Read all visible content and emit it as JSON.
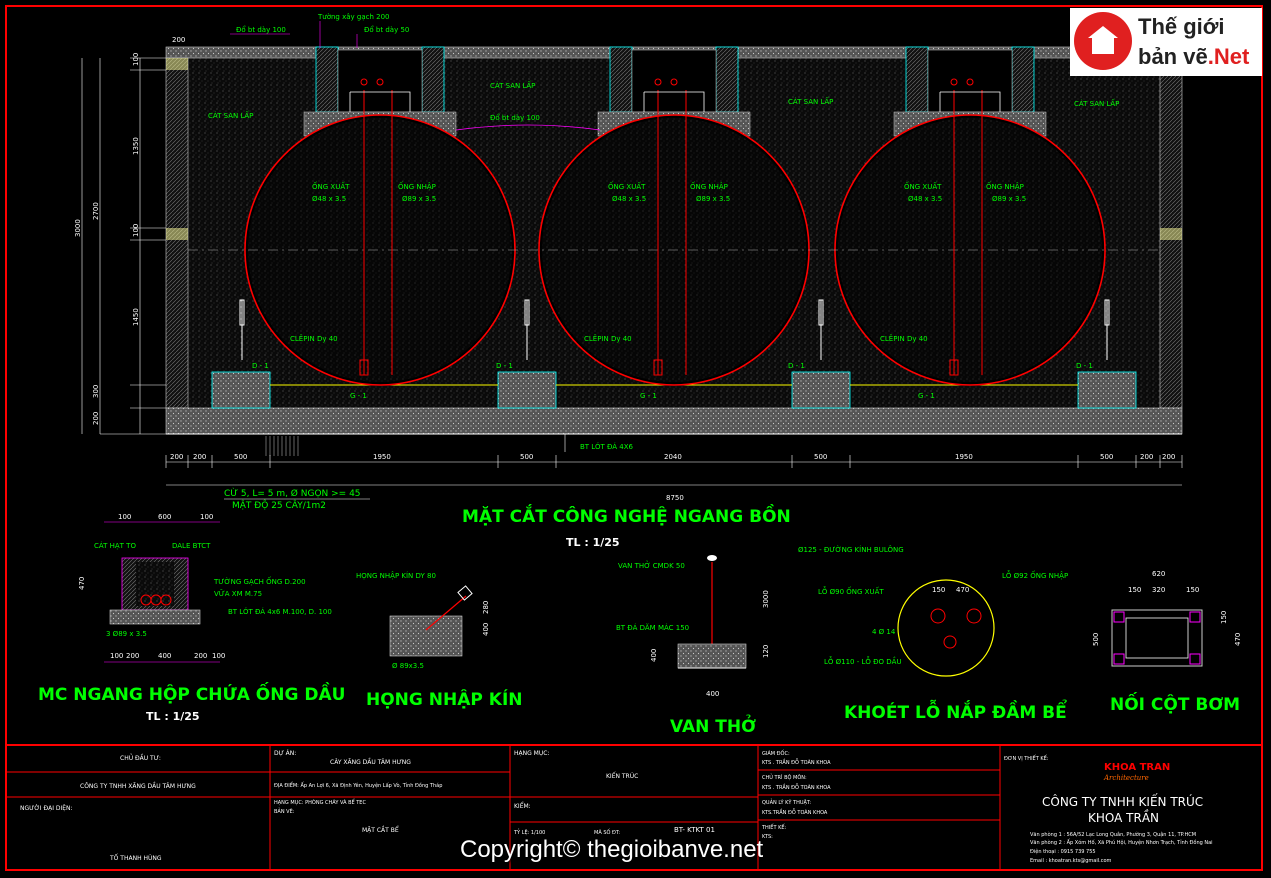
{
  "logo": {
    "line1": "Thế giới",
    "line2": "bản vẽ",
    "line2b": ".Net"
  },
  "watermark": "Copyright© thegioibanve.net",
  "main_title": "MẶT CẮT CÔNG NGHỆ NGANG BỒN",
  "main_scale": "TL : 1/25",
  "detail_titles": {
    "hop": "MC NGANG HỘP CHỨA ỐNG DẦU",
    "hop_scale": "TL : 1/25",
    "hong": "HỌNG NHẬP KÍN",
    "van": "VAN THỞ",
    "khoet": "KHOÉT LỖ NẮP ĐẦM BỂ",
    "noi": "NỐI CỘT BƠM"
  },
  "top_labels": {
    "t1": "Đổ bt dày 100",
    "t2": "Tường xây gạch 200",
    "t3": "Đổ bt dày 50",
    "cat1": "CÁT SAN LẤP",
    "cat2": "CÁT SAN LẤP",
    "cat3": "CÁT SAN LẤP",
    "cat4": "CÁT SAN LẤP",
    "bt100": "Đổ bt dày 100"
  },
  "tank_labels": {
    "xuat": "ỐNG XUẤT",
    "xuat_d": "Ø48 x 3.5",
    "nhap": "ỐNG NHẬP",
    "nhap_d": "Ø89 x 3.5",
    "clepin": "CLÊPIN Dy 40",
    "d1": "D - 1",
    "g1": "G - 1"
  },
  "bottom_labels": {
    "btlot": "BT LÓT ĐÁ 4X6",
    "cu": "CỪ 5, L= 5 m, Ø NGỌN >= 45",
    "matdo": "MẬT ĐỘ 25 CÂY/1m2"
  },
  "dims_bottom": [
    "200",
    "200",
    "500",
    "1950",
    "500",
    "2040",
    "500",
    "1950",
    "500",
    "200",
    "200"
  ],
  "dim_total": "8750",
  "dims_left": {
    "d100": "100",
    "d1350": "1350",
    "d100b": "100",
    "d1450": "1450",
    "d300": "300",
    "d200": "200",
    "d2700": "2700",
    "d3000": "3000",
    "d200top": "200",
    "d300b": "300"
  },
  "hop": {
    "cat": "CÁT HẠT TO",
    "dale": "DALE BTCT",
    "tuong": "TƯỜNG GẠCH ỐNG D.200",
    "vua": "VỮA XM M.75",
    "btlot": "BT LÓT ĐÁ 4x6 M.100, D. 100",
    "ong": "3 Ø89 x 3.5",
    "d100": "100",
    "d600": "600",
    "d100b": "100",
    "d470": "470",
    "dims": [
      "100",
      "200",
      "400",
      "200",
      "100"
    ]
  },
  "hong": {
    "lbl": "HỌNG NHẬP KÍN DY 80",
    "ong": "Ø 89x3.5",
    "d280": "280",
    "d400": "400"
  },
  "van": {
    "lbl1": "VAN THỞ CMDK 50",
    "lbl2": "BT ĐÁ DĂM MÁC 150",
    "d3000": "3000",
    "d400": "400",
    "d400b": "400",
    "d120": "120"
  },
  "khoet": {
    "l1": "Ø125 - ĐƯỜNG KÍNH BULÔNG",
    "l2": "LỖ Ø92 ỐNG NHẬP",
    "l3": "LỖ Ø90 ỐNG XUẤT",
    "l4": "4 Ø 14",
    "l5": "LỖ Ø110 - LỖ ĐO DẦU",
    "d150": "150",
    "d470": "470"
  },
  "noi": {
    "d620": "620",
    "dims": [
      "150",
      "320",
      "150"
    ],
    "d500": "500",
    "d150": "150",
    "d470": "470"
  },
  "titleblock": {
    "chu_dau_tu_lbl": "CHỦ ĐẦU TƯ:",
    "chu_dau_tu": "CÔNG TY TNHH XĂNG DẦU TÂM HƯNG",
    "nguoi_dai_dien_lbl": "NGƯỜI ĐẠI DIỆN:",
    "nguoi_dai_dien": "TỐ THANH HÙNG",
    "du_an_lbl": "DỰ ÁN:",
    "du_an": "CÂY XĂNG DẦU TÂM HƯNG",
    "dia_diem": "ĐỊA ĐIỂM:   Ấp An Lợi 6, Xã Định Yên, Huyện Lấp Vò, Tỉnh Đồng Tháp",
    "hang_muc_pc": "HẠNG MỤC: PHÒNG CHÁY VÀ BỂ TEC",
    "ban_ve_lbl": "BẢN VẼ:",
    "ban_ve": "MẶT CẮT BỂ",
    "hang_muc_lbl": "HẠNG MỤC:",
    "hang_muc": "KIẾN TRÚC",
    "kiem_lbl": "KIỂM:",
    "ty_le": "TỶ LỆ:  1/100",
    "ma_so": "MÃ SỐ ĐT:",
    "ma": "BT- KTKT 01",
    "giam_doc_lbl": "GIÁM ĐỐC:",
    "giam_doc": "KTS . TRẦN ĐỖ TOÀN KHOA",
    "chu_tri_lbl": "CHỦ TRÌ BỘ MÔN:",
    "chu_tri": "KTS . TRẦN ĐỖ TOÀN KHOA",
    "quan_ly_lbl": "QUẢN LÝ KỸ THUẬT:",
    "quan_ly": "KTS.TRẦN ĐỖ TOÀN KHOA",
    "thiet_ke_lbl": "THIẾT KẾ:",
    "thiet_ke": "KTS:",
    "don_vi_lbl": "ĐƠN VỊ THIẾT KẾ:",
    "co_logo": "KHOA TRAN",
    "co_logo2": "Architecture",
    "cong_ty": "CÔNG TY TNHH KIẾN TRÚC",
    "cong_ty2": "KHOA TRẦN",
    "vp1": "Văn phòng 1 : 56A/52 Lạc Long Quân, Phường 3, Quận 11, TP.HCM",
    "vp2": "Văn phòng 2 : Ấp Xóm Hố, Xã Phú Hội, Huyện Nhơn Trạch, Tỉnh Đồng Nai",
    "dt": "Điện thoại : 0915 739 755",
    "email": "Email         :  khoatran.kts@gmail.com"
  },
  "colors": {
    "red": "#ff0000",
    "green": "#00ff00",
    "magenta": "#ff00ff",
    "cyan": "#00ffff",
    "yellow": "#ffff00",
    "white": "#ffffff"
  }
}
